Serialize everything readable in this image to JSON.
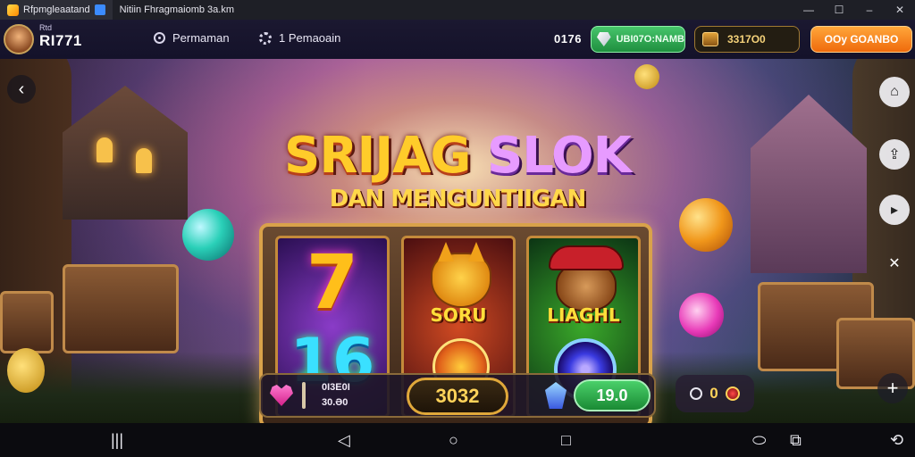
{
  "window": {
    "tabs": [
      {
        "label": "Rfpmgleaatand"
      },
      {
        "label": "Nitiin Fhragmaiomb  3a.km"
      }
    ],
    "controls": [
      "—",
      "☐",
      "–",
      "✕"
    ]
  },
  "header": {
    "player_label": "Rtd",
    "player_name": "RI771",
    "menu": [
      {
        "label": "Permaman",
        "icon": "info-icon"
      },
      {
        "label": "1 Pemaoain",
        "icon": "settings-icon"
      }
    ],
    "counter": "0176",
    "gems_label": "UBI07O:NAMB",
    "chest_value": "3317O0",
    "cta_label": "OOy GOANBO"
  },
  "game": {
    "title_part1": "SRIJAG",
    "title_part2": "SLOK",
    "subtitle": "DAN MENGUNTIIGAN",
    "reels": [
      {
        "top_symbol": "7",
        "bottom_symbol": "16"
      },
      {
        "top_label": "SORU"
      },
      {
        "top_label": "LIAGHL"
      }
    ],
    "controls": {
      "line1": "0I3E0I",
      "line2": "30.Ə0",
      "spin_value": "3032",
      "bet_value": "19.0",
      "coin_value": "0"
    }
  },
  "colors": {
    "accent_green": "#3fbf63",
    "accent_orange": "#f88220",
    "gold": "#ffcc2a"
  }
}
